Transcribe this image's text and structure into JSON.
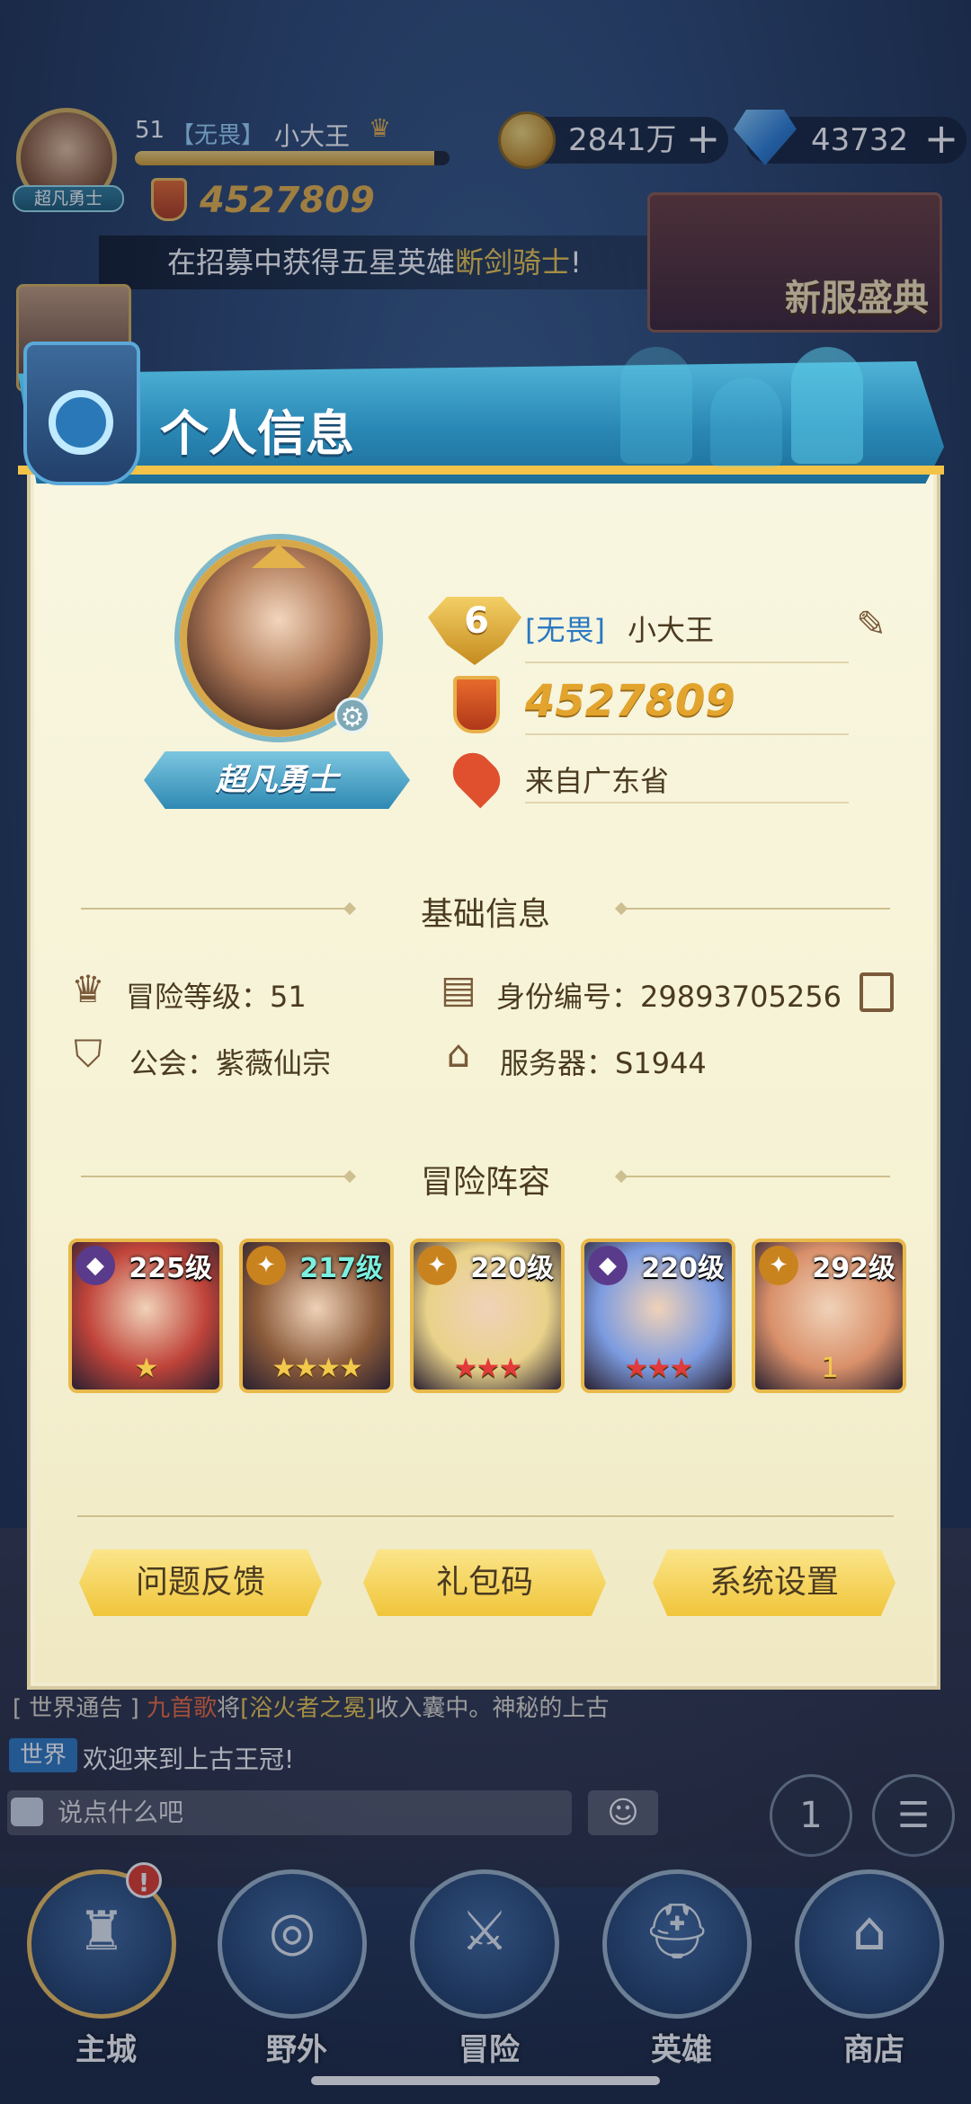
{
  "hud": {
    "level": "51",
    "guild_tag": "【无畏】",
    "player_name": "小大王",
    "rank_badge": "超凡勇士",
    "power": "4527809",
    "exp_fraction": 0.95,
    "gold": "2841万",
    "diamonds": "43732",
    "plus_glyph": "+"
  },
  "banner": {
    "prefix": "在招募中获得五星英雄",
    "hero": "断剑骑士",
    "suffix": "!"
  },
  "event": {
    "label": "新服盛典"
  },
  "panel": {
    "title": "个人信息",
    "profile": {
      "rank_badge": "超凡勇士",
      "vip_level": "6",
      "guild_tag": "[无畏]",
      "name": "小大王",
      "power": "4527809",
      "location": "来自广东省"
    },
    "basic_info": {
      "title": "基础信息",
      "adventure_level": "冒险等级：51",
      "id_number": "身份编号：29893705256",
      "guild": "公会：紫薇仙宗",
      "server": "服务器：S1944"
    },
    "lineup": {
      "title": "冒险阵容",
      "heroes": [
        {
          "level": "225级",
          "stars": "★",
          "class_glyph": "◆",
          "color": "#c0443a"
        },
        {
          "level": "217级",
          "stars": "★★★★",
          "class_glyph": "✦",
          "color": "#8a5a3a"
        },
        {
          "level": "220级",
          "stars": "★★★",
          "class_glyph": "✦",
          "color": "#e9d28a"
        },
        {
          "level": "220级",
          "stars": "★★★",
          "class_glyph": "◆",
          "color": "#7c9be0"
        },
        {
          "level": "292级",
          "stars": "1",
          "class_glyph": "✦",
          "color": "#d9906a"
        }
      ]
    },
    "buttons": {
      "feedback": "问题反馈",
      "gift_code": "礼包码",
      "settings": "系统设置"
    }
  },
  "chat": {
    "notice_tag": "[ 世界通告 ]",
    "notice_name": "九首歌",
    "notice_mid": "将",
    "notice_item": "[浴火者之冕]",
    "notice_tail": "收入囊中。神秘的上古",
    "world_tag": "世界",
    "world_msg": "欢迎来到上古王冠!",
    "input_placeholder": "说点什么吧",
    "emoji_glyph": "☺"
  },
  "nav": {
    "items": [
      {
        "label": "主城",
        "glyph": "♜"
      },
      {
        "label": "野外",
        "glyph": "◎"
      },
      {
        "label": "冒险",
        "glyph": "⚔"
      },
      {
        "label": "英雄",
        "glyph": "⛑"
      },
      {
        "label": "商店",
        "glyph": "⌂"
      }
    ],
    "alert": "!"
  },
  "side_buttons": {
    "rank_glyph": "1",
    "bag_glyph": "☰"
  },
  "colors": {
    "panel_bg": "#f6f2d4",
    "header_blue": "#2a88b5",
    "gold": "#e3a42e",
    "button_yellow": "#f0c53a"
  }
}
